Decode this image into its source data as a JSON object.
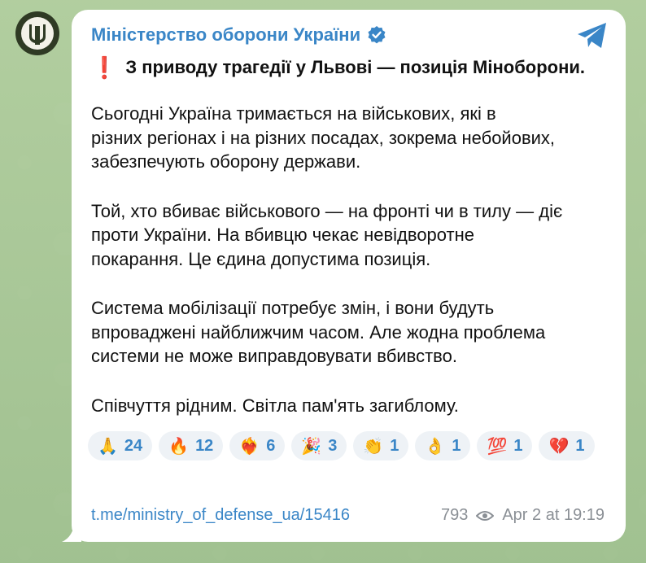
{
  "channel": {
    "name": "Міністерство оборони України",
    "verified_icon": "verified-badge-icon",
    "avatar_icon": "trident-emblem-icon"
  },
  "post": {
    "alert_icon": "❗",
    "title": "З приводу трагедії у Львові — позиція Міноборони.",
    "paragraphs": [
      "Сьогодні Україна тримається на військових, які в\nрізних регіонах і на різних посадах, зокрема небойових,\nзабезпечують оборону держави.",
      "Той, хто вбиває військового — на фронті чи в тилу — діє\nпроти України. На вбивцю чекає невідворотне\nпокарання. Це єдина допустима позиція.",
      "Система мобілізації потребує змін, і вони будуть\nвпроваджені найближчим часом. Але жодна проблема\nсистеми не може виправдовувати вбивство.",
      "Співчуття рідним. Світла пам'ять загиблому."
    ]
  },
  "reactions": [
    {
      "emoji": "🙏",
      "count": "24"
    },
    {
      "emoji": "🔥",
      "count": "12"
    },
    {
      "emoji": "❤️‍🔥",
      "count": "6"
    },
    {
      "emoji": "🎉",
      "count": "3"
    },
    {
      "emoji": "👏",
      "count": "1"
    },
    {
      "emoji": "👌",
      "count": "1"
    },
    {
      "emoji": "💯",
      "count": "1"
    },
    {
      "emoji": "💔",
      "count": "1"
    }
  ],
  "footer": {
    "link": "t.me/ministry_of_defense_ua/15416",
    "views": "793",
    "timestamp": "Apr 2 at 19:19"
  },
  "colors": {
    "accent": "#3a86c7",
    "alert": "#e02424",
    "background": "#a9c79a"
  }
}
